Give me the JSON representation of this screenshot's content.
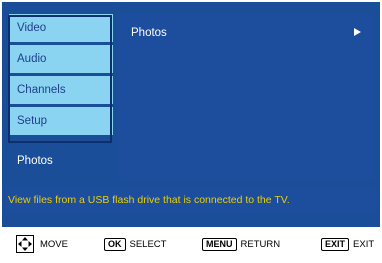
{
  "colors": {
    "background": "#1a4e98",
    "menu_item_bg": "#8ad4f2",
    "menu_item_text": "#1f3f8c",
    "active_text": "#ffffff",
    "help_text": "#e8d000"
  },
  "sidebar": {
    "items": [
      {
        "label": "Video"
      },
      {
        "label": "Audio"
      },
      {
        "label": "Channels"
      },
      {
        "label": "Setup"
      },
      {
        "label": "Photos"
      }
    ]
  },
  "panel": {
    "item": "Photos",
    "arrow_icon": "arrow-right-icon"
  },
  "help_text": "View files from a USB flash drive that is connected to the TV.",
  "footer": {
    "move_label": "MOVE",
    "ok_key": "OK",
    "select_label": "SELECT",
    "menu_key": "MENU",
    "return_label": "RETURN",
    "exit_key": "EXIT",
    "exit_label": "EXIT"
  }
}
